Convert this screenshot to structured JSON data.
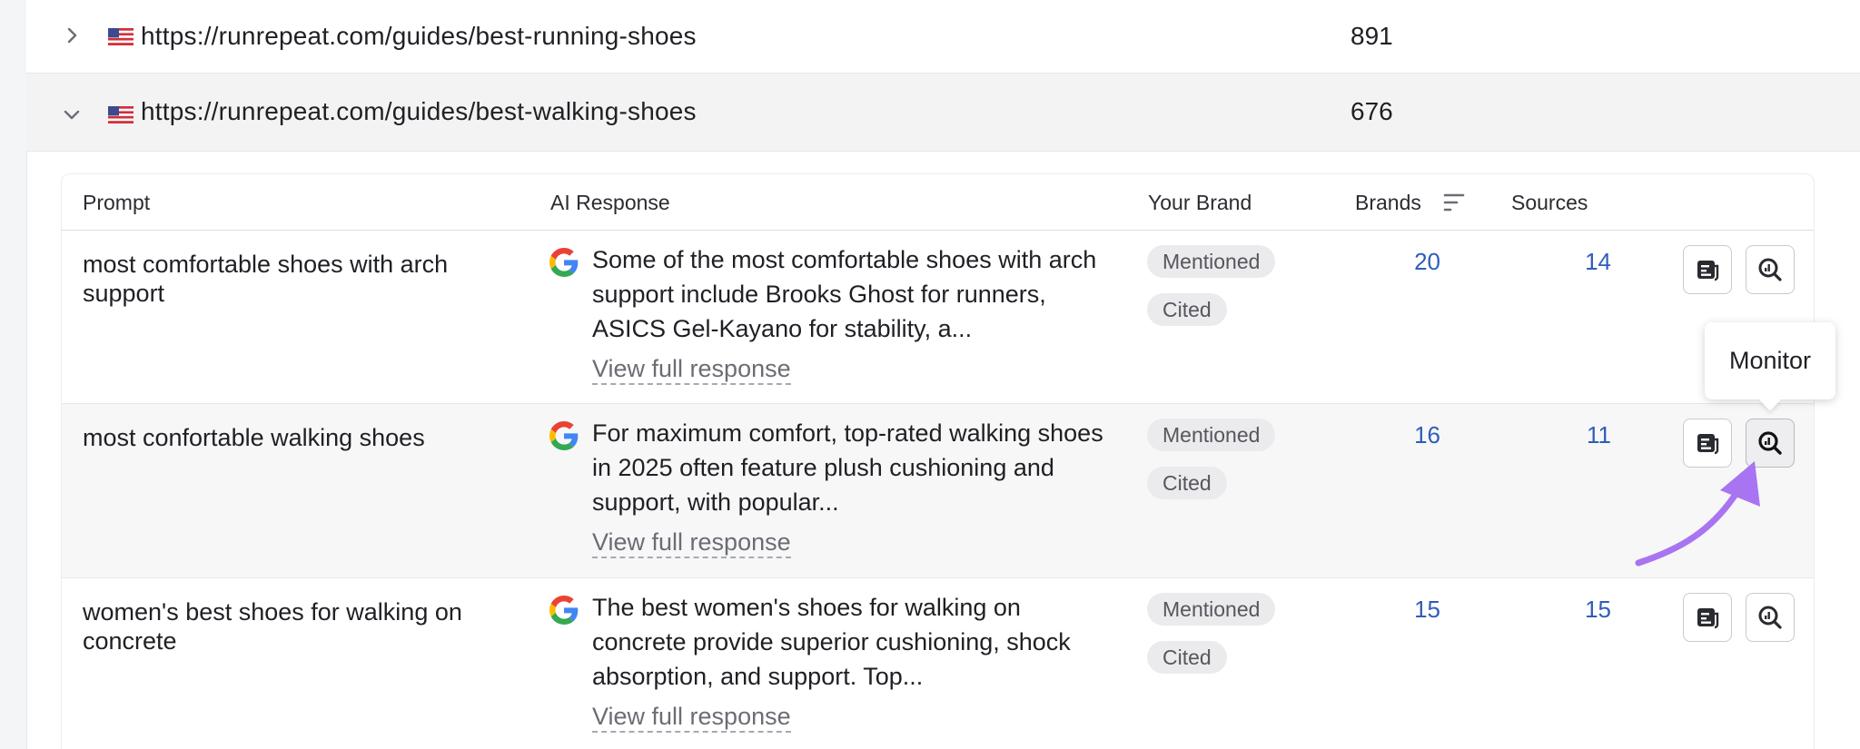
{
  "url_rows": [
    {
      "url": "https://runrepeat.com/guides/best-running-shoes",
      "count": "891",
      "expanded": false
    },
    {
      "url": "https://runrepeat.com/guides/best-walking-shoes",
      "count": "676",
      "expanded": true
    }
  ],
  "table": {
    "headers": {
      "prompt": "Prompt",
      "ai_response": "AI Response",
      "your_brand": "Your Brand",
      "brands": "Brands",
      "sources": "Sources"
    },
    "rows": [
      {
        "prompt": "most comfortable shoes with arch support",
        "response": "Some of the most comfortable shoes with arch support include Brooks Ghost for runners, ASICS Gel-Kayano for stability, a...",
        "view_full": "View full response",
        "badges": [
          "Mentioned",
          "Cited"
        ],
        "brands": "20",
        "sources": "14"
      },
      {
        "prompt": "most confortable walking shoes",
        "response": "For maximum comfort, top-rated walking shoes in 2025 often feature plush cushioning and support, with popular...",
        "view_full": "View full response",
        "badges": [
          "Mentioned",
          "Cited"
        ],
        "brands": "16",
        "sources": "11"
      },
      {
        "prompt": "women's best shoes for walking on concrete",
        "response": "The best women's shoes for walking on concrete provide superior cushioning, shock absorption, and support. Top...",
        "view_full": "View full response",
        "badges": [
          "Mentioned",
          "Cited"
        ],
        "brands": "15",
        "sources": "15"
      }
    ]
  },
  "tooltip": {
    "text": "Monitor"
  },
  "colors": {
    "link_blue": "#2f5dba",
    "arrow": "#a974f2"
  },
  "icons": {
    "expand_collapsed": "chevron-right-icon",
    "expand_open": "chevron-down-icon",
    "flag": "us-flag-icon",
    "engine": "google-icon",
    "sort": "sort-icon",
    "action1": "view-response-icon",
    "action2": "monitor-icon"
  }
}
